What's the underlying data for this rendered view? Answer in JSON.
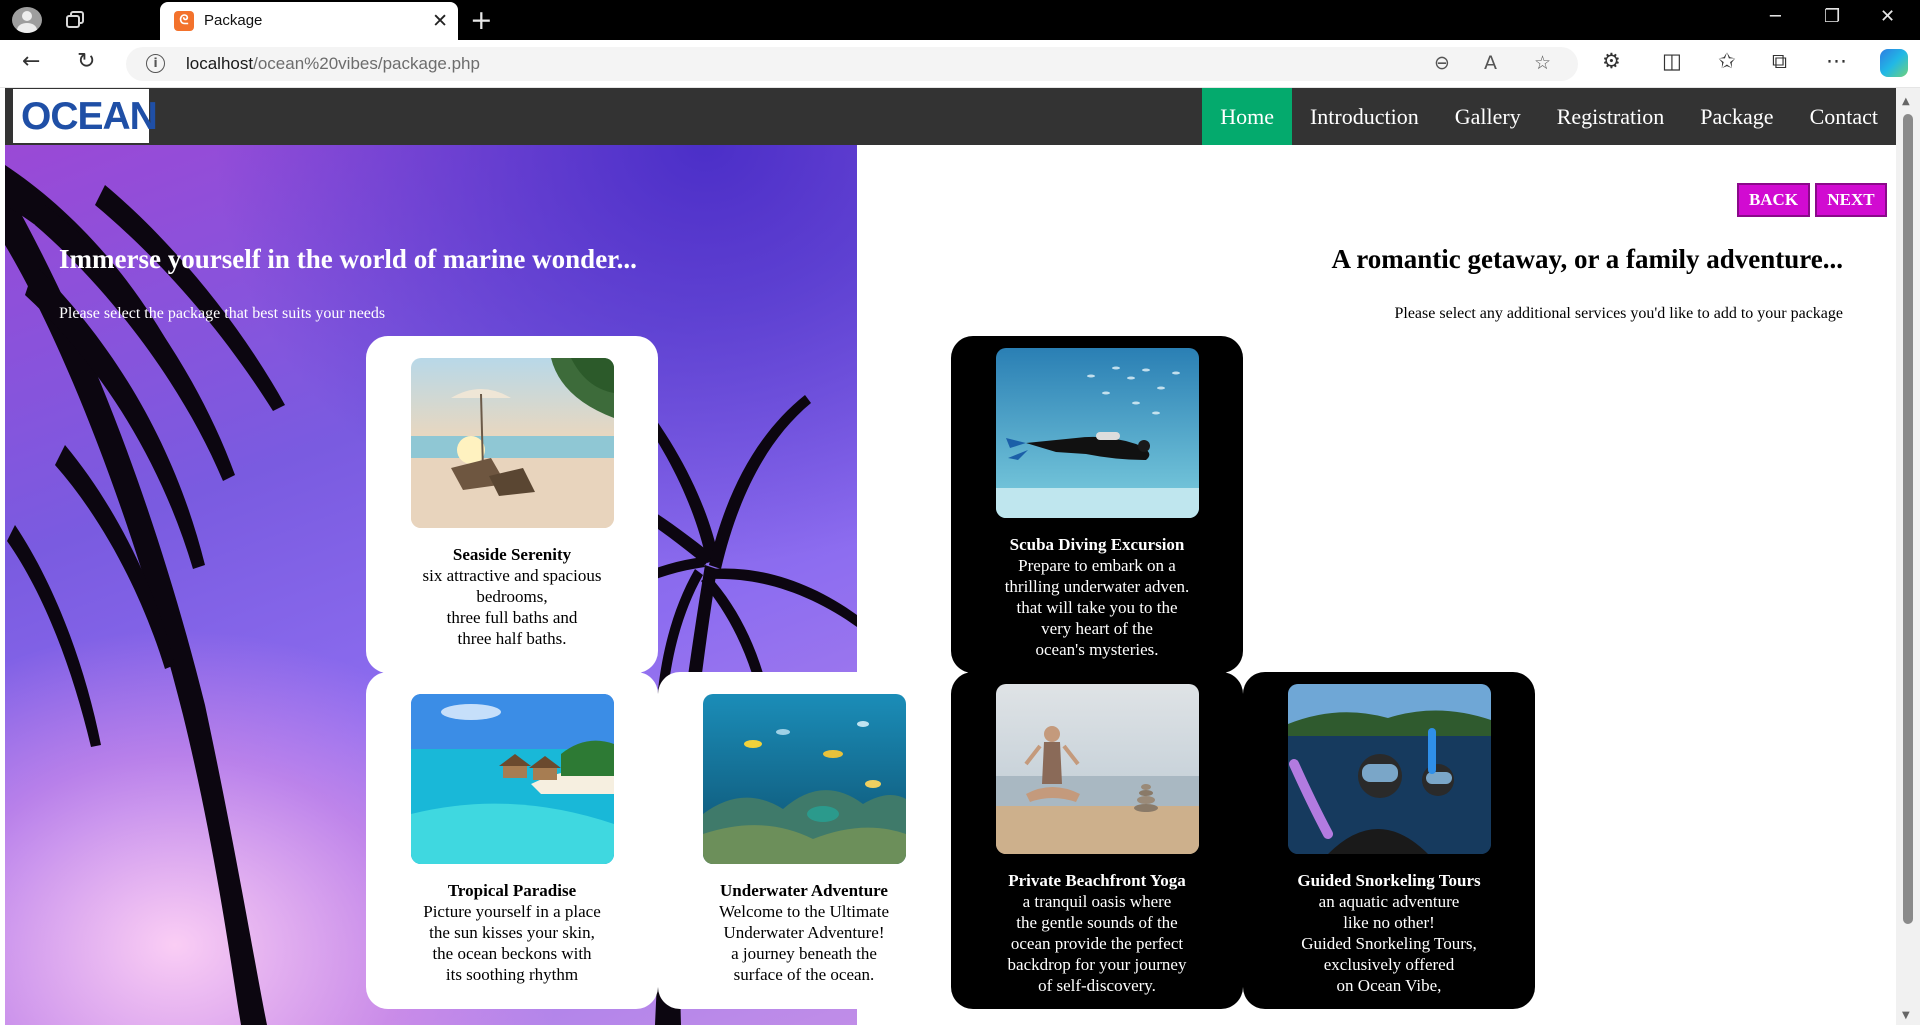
{
  "browser": {
    "tab_title": "Package",
    "tab_icon": "xampp-icon",
    "url_host": "localhost",
    "url_path": "/ocean%20vibes/package.php",
    "new_tab_glyph": "+",
    "close_glyph": "✕"
  },
  "site": {
    "logo": "OCEAN",
    "nav": [
      "Home",
      "Introduction",
      "Gallery",
      "Registration",
      "Package",
      "Contact"
    ],
    "active_nav": "Home",
    "accent_color": "#04aa6d",
    "button_color": "#d10bd1"
  },
  "left": {
    "title": "Immerse yourself in the world of marine wonder...",
    "subtitle": "Please select the package that best suits your needs"
  },
  "right": {
    "title": "A romantic getaway, or a family adventure...",
    "subtitle": "Please select any additional services you'd like to add to your package",
    "back_label": "BACK",
    "next_label": "NEXT"
  },
  "packages": [
    {
      "title": "Seaside Serenity",
      "lines": [
        "six attractive and spacious",
        "bedrooms,",
        "three full baths and",
        "three half baths."
      ],
      "image": "beach-loungers-umbrella"
    },
    {
      "title": "Tropical Paradise",
      "lines": [
        "Picture yourself in a place",
        "the sun kisses your skin,",
        "the ocean beckons with",
        "its soothing rhythm"
      ],
      "image": "island-overwater-villas"
    },
    {
      "title": "Underwater Adventure",
      "lines": [
        "Welcome to the Ultimate",
        "Underwater Adventure!",
        "a journey beneath the",
        "surface of the ocean."
      ],
      "image": "coral-reef-fish"
    }
  ],
  "services": [
    {
      "title": "Scuba Diving Excursion",
      "lines": [
        "Prepare to embark on a",
        "thrilling underwater adven.",
        "that will take you to the",
        "very heart of the",
        "ocean's mysteries."
      ],
      "image": "scuba-diver"
    },
    {
      "title": "Private Beachfront Yoga",
      "lines": [
        "a tranquil oasis where",
        "the gentle sounds of the",
        "ocean provide the perfect",
        "backdrop for your journey",
        "of self-discovery."
      ],
      "image": "beach-yoga"
    },
    {
      "title": "Guided Snorkeling Tours",
      "lines": [
        "an aquatic adventure",
        "like no other!",
        "Guided Snorkeling Tours,",
        "exclusively offered",
        "on Ocean Vibe,"
      ],
      "image": "snorkelers"
    }
  ]
}
